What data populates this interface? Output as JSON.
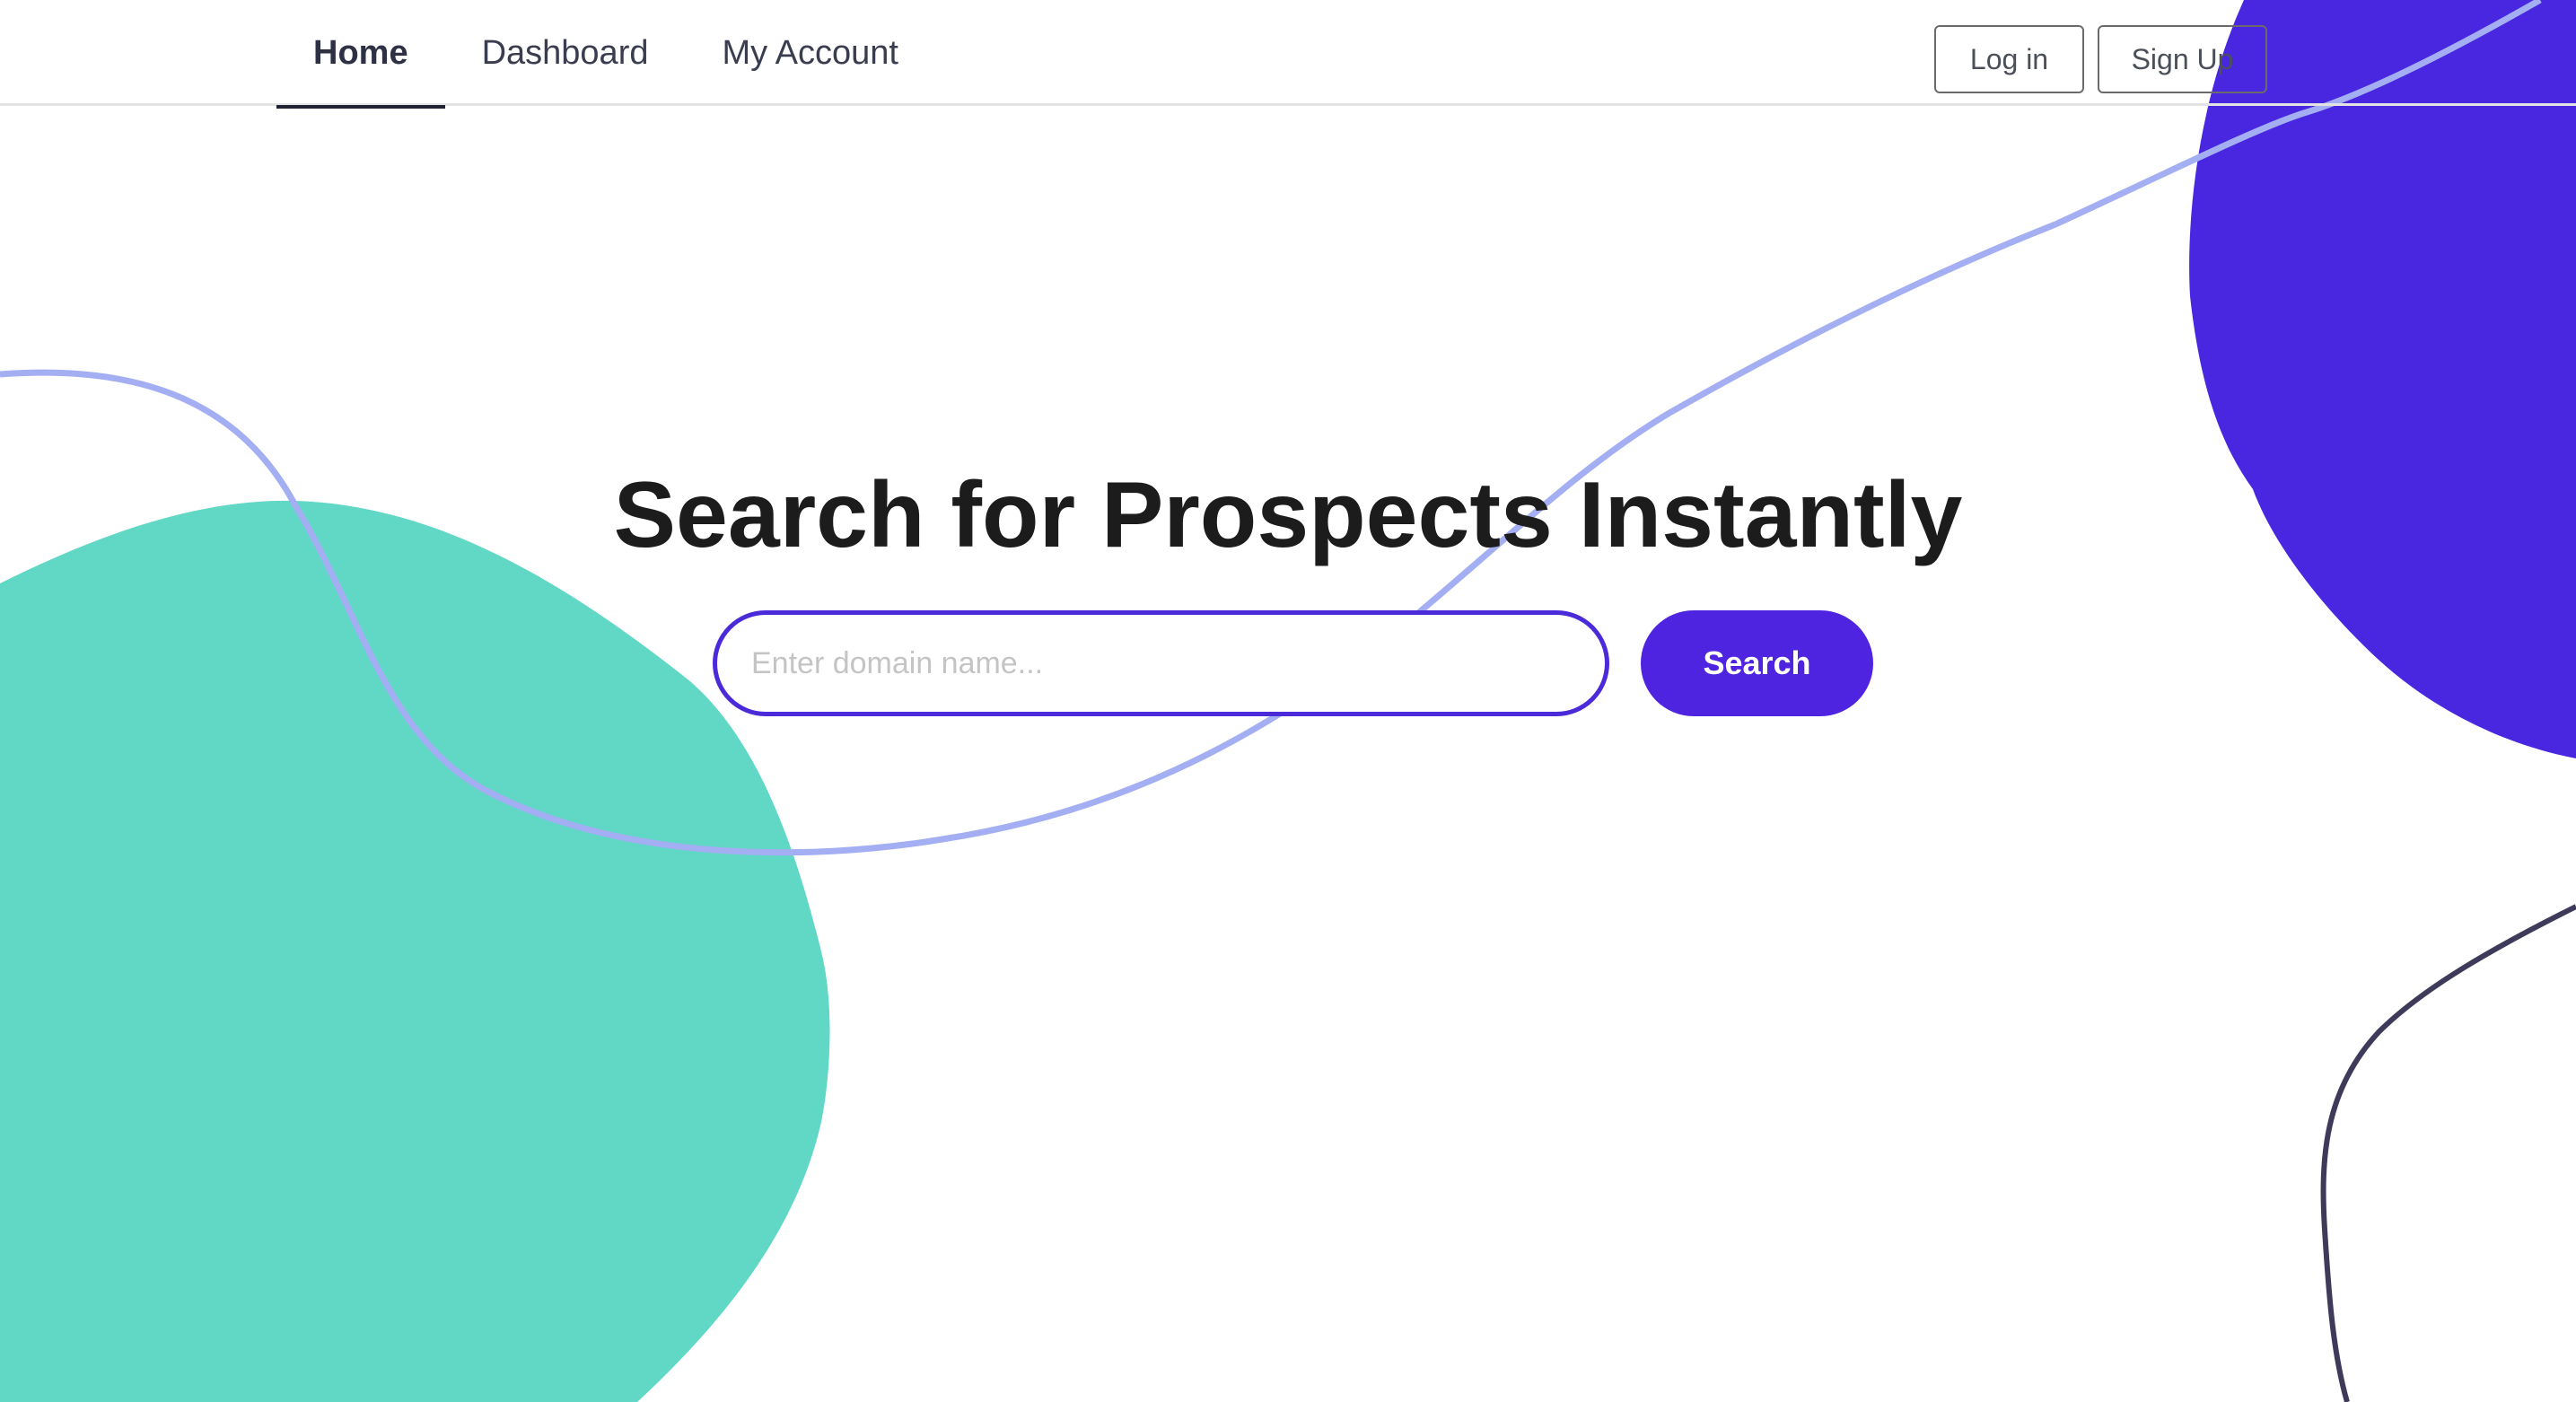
{
  "nav": {
    "tabs": [
      {
        "label": "Home",
        "active": true
      },
      {
        "label": "Dashboard",
        "active": false
      },
      {
        "label": "My Account",
        "active": false
      }
    ],
    "login_label": "Log in",
    "signup_label": "Sign Up"
  },
  "hero": {
    "title": "Search for Prospects Instantly",
    "search_placeholder": "Enter domain name...",
    "search_value": "",
    "search_button_label": "Search"
  },
  "colors": {
    "accent": "#4f24e0",
    "teal_blob": "#61d7c5",
    "purple_blob": "#4926e0",
    "light_curve": "#a3aff2",
    "dark_curve": "#3d3a5a"
  }
}
